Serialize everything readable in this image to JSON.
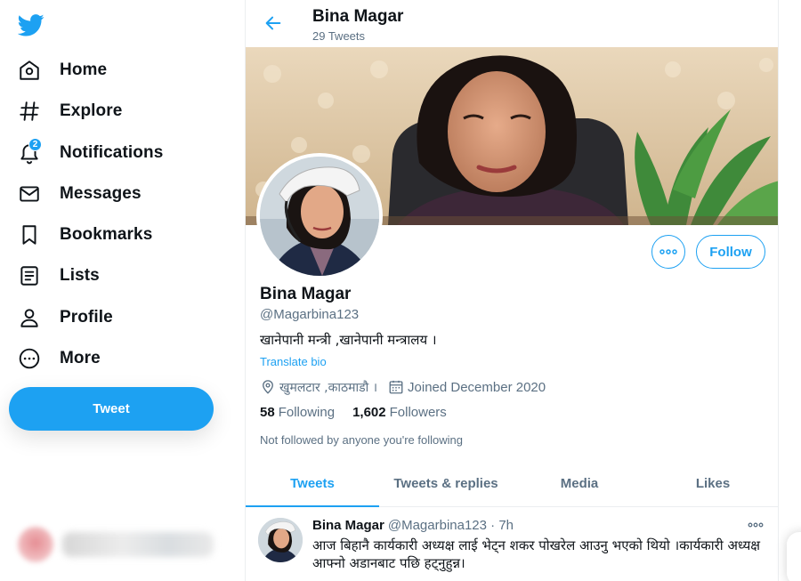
{
  "colors": {
    "accent": "#1da1f2",
    "text": "#0f1419",
    "muted": "#5b7083",
    "border": "#ebeef0"
  },
  "sidebar": {
    "logo_icon": "twitter-bird-icon",
    "items": [
      {
        "label": "Home",
        "icon": "home-icon"
      },
      {
        "label": "Explore",
        "icon": "hashtag-icon"
      },
      {
        "label": "Notifications",
        "icon": "bell-icon",
        "badge": "2"
      },
      {
        "label": "Messages",
        "icon": "envelope-icon"
      },
      {
        "label": "Bookmarks",
        "icon": "bookmark-icon"
      },
      {
        "label": "Lists",
        "icon": "list-icon"
      },
      {
        "label": "Profile",
        "icon": "person-icon"
      },
      {
        "label": "More",
        "icon": "more-circle-icon"
      }
    ],
    "tweet_button": "Tweet"
  },
  "header": {
    "name": "Bina Magar",
    "tweet_count": "29 Tweets"
  },
  "profile": {
    "name": "Bina Magar",
    "handle": "@Magarbina123",
    "bio": "खानेपानी मन्त्री ,खानेपानी मन्त्रालय ।",
    "translate": "Translate bio",
    "location": "खुमलटार ,काठमाडौ ।",
    "joined": "Joined December 2020",
    "following_count": "58",
    "following_label": "Following",
    "followers_count": "1,602",
    "followers_label": "Followers",
    "not_followed": "Not followed by anyone you're following",
    "follow_button": "Follow"
  },
  "tabs": [
    {
      "label": "Tweets",
      "active": true
    },
    {
      "label": "Tweets & replies",
      "active": false
    },
    {
      "label": "Media",
      "active": false
    },
    {
      "label": "Likes",
      "active": false
    }
  ],
  "tweet": {
    "name": "Bina Magar",
    "handle": "@Magarbina123 · 7h",
    "text": "आज बिहानै कार्यकारी अध्यक्ष लाई भेट्न शकर पोखरेल आउनु भएको थियो ।कार्यकारी अध्यक्ष  आफ्नो अडानबाट पछि हट्नुहुन्न।"
  }
}
